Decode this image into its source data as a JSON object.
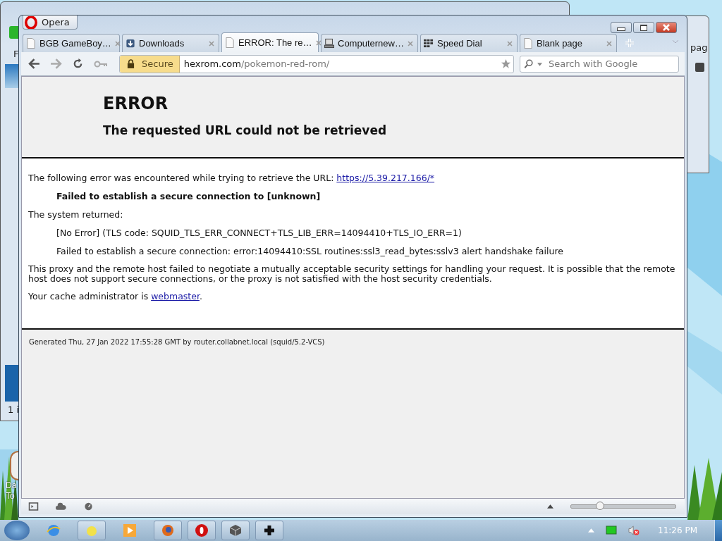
{
  "desktop": {
    "back_window_menu": "F",
    "back_window_status": "1 i",
    "right_window_text": "pag",
    "desktop_icon_label": [
      "Da",
      "To"
    ]
  },
  "window": {
    "menu_button": "Opera"
  },
  "tabs": [
    {
      "title": "BGB GameBoy…",
      "kind": "page",
      "selected": false
    },
    {
      "title": "Downloads",
      "kind": "download",
      "selected": false
    },
    {
      "title": "ERROR: The re…",
      "kind": "page",
      "selected": true
    },
    {
      "title": "Computernew…",
      "kind": "computer",
      "selected": false
    },
    {
      "title": "Speed Dial",
      "kind": "grid",
      "selected": false
    },
    {
      "title": "Blank page",
      "kind": "page",
      "selected": false
    }
  ],
  "address": {
    "security": "Secure",
    "host": "hexrom.com",
    "path": "/pokemon-red-rom/"
  },
  "search": {
    "placeholder": "Search with Google"
  },
  "page": {
    "heading": "ERROR",
    "subheading": "The requested URL could not be retrieved",
    "intro": "The following error was encountered while trying to retrieve the URL: ",
    "intro_link": "https://5.39.217.166/*",
    "error_detail": "Failed to establish a secure connection to [unknown]",
    "system_label": "The system returned:",
    "system_lines": [
      "[No Error] (TLS code: SQUID_TLS_ERR_CONNECT+TLS_LIB_ERR=14094410+TLS_IO_ERR=1)",
      "Failed to establish a secure connection: error:14094410:SSL routines:ssl3_read_bytes:sslv3 alert handshake failure"
    ],
    "explanation": "This proxy and the remote host failed to negotiate a mutually acceptable security settings for handling your request. It is possible that the remote host does not support secure connections, or the proxy is not satisfied with the host security credentials.",
    "admin_text": "Your cache administrator is ",
    "admin_link": "webmaster",
    "admin_end": ".",
    "footer": "Generated Thu, 27 Jan 2022 17:55:28 GMT by router.collabnet.local (squid/5.2-VCS)"
  },
  "status_bar": {
    "zoom": {
      "level": 0.28
    }
  },
  "taskbar": {
    "clock": "11:26 PM"
  }
}
